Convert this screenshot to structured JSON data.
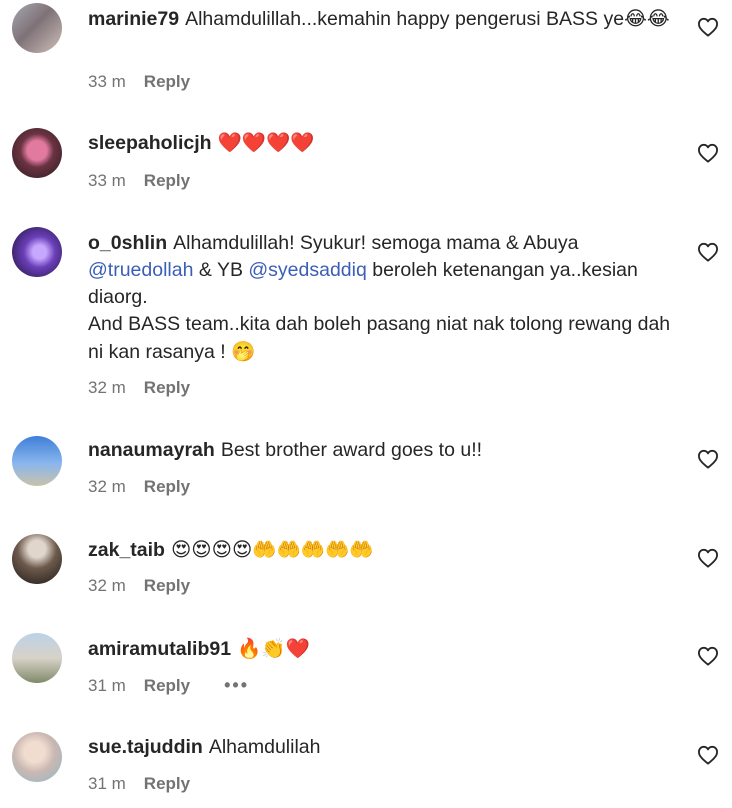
{
  "comments": [
    {
      "username": "marinie79",
      "text_parts": [
        {
          "text": "Alhamdulillah...kemahin happy pengerusi BASS ye",
          "type": "text"
        },
        {
          "text": "😂😂",
          "type": "emoji"
        }
      ],
      "time": "33 m",
      "reply_label": "Reply"
    },
    {
      "username": "sleepaholicjh",
      "text_parts": [
        {
          "text": "❤️❤️❤️❤️",
          "type": "emoji"
        }
      ],
      "time": "33 m",
      "reply_label": "Reply"
    },
    {
      "username": "o_0shlin",
      "text_parts": [
        {
          "text": "Alhamdulillah! Syukur! semoga mama & Abuya ",
          "type": "text"
        },
        {
          "text": "@truedollah",
          "type": "mention"
        },
        {
          "text": " & YB ",
          "type": "text"
        },
        {
          "text": "@syedsaddiq",
          "type": "mention"
        },
        {
          "text": " beroleh ketenangan ya..kesian diaorg.",
          "type": "text"
        },
        {
          "text": "\n",
          "type": "break"
        },
        {
          "text": "And BASS team..kita dah boleh pasang niat nak tolong rewang dah ni kan rasanya ! ",
          "type": "text"
        },
        {
          "text": "🤭",
          "type": "emoji"
        }
      ],
      "time": "32 m",
      "reply_label": "Reply"
    },
    {
      "username": "nanaumayrah",
      "text_parts": [
        {
          "text": "Best brother award goes to u!!",
          "type": "text"
        }
      ],
      "time": "32 m",
      "reply_label": "Reply"
    },
    {
      "username": "zak_taib",
      "text_parts": [
        {
          "text": "😍😍😍😍🤲🤲🤲🤲🤲",
          "type": "emoji"
        }
      ],
      "time": "32 m",
      "reply_label": "Reply"
    },
    {
      "username": "amiramutalib91",
      "text_parts": [
        {
          "text": "🔥👏❤️",
          "type": "emoji"
        }
      ],
      "time": "31 m",
      "reply_label": "Reply",
      "more_label": "•••"
    },
    {
      "username": "sue.tajuddin",
      "text_parts": [
        {
          "text": "Alhamdulilah",
          "type": "text"
        }
      ],
      "time": "31 m",
      "reply_label": "Reply"
    }
  ],
  "icons": {
    "heart": "heart-outline-icon",
    "avatar": "user-avatar"
  },
  "colors": {
    "text": "#262626",
    "secondary": "#737373",
    "mention": "#3B5EB8"
  }
}
